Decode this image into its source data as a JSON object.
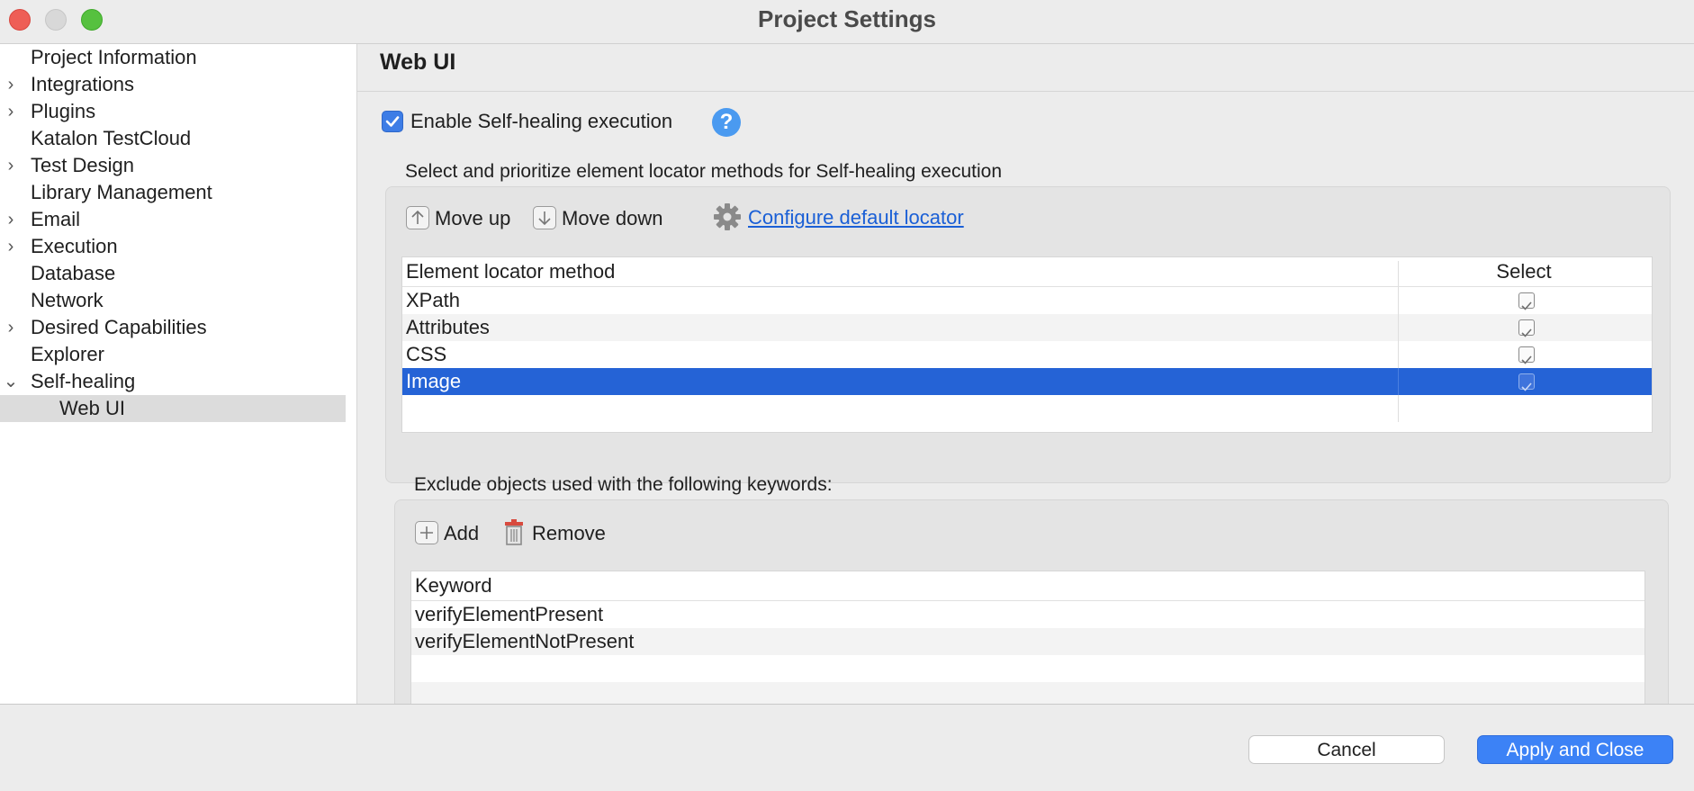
{
  "window": {
    "title": "Project Settings"
  },
  "sidebar": {
    "items": [
      {
        "label": "Project Information",
        "expander": ""
      },
      {
        "label": "Integrations",
        "expander": "›"
      },
      {
        "label": "Plugins",
        "expander": "›"
      },
      {
        "label": "Katalon TestCloud",
        "expander": ""
      },
      {
        "label": "Test Design",
        "expander": "›"
      },
      {
        "label": "Library Management",
        "expander": ""
      },
      {
        "label": "Email",
        "expander": "›"
      },
      {
        "label": "Execution",
        "expander": "›"
      },
      {
        "label": "Database",
        "expander": ""
      },
      {
        "label": "Network",
        "expander": ""
      },
      {
        "label": "Desired Capabilities",
        "expander": "›"
      },
      {
        "label": "Explorer",
        "expander": ""
      },
      {
        "label": "Self-healing",
        "expander": "⌄"
      },
      {
        "label": "Web UI",
        "expander": "",
        "selected": true
      }
    ]
  },
  "main": {
    "title": "Web UI",
    "enable_label": "Enable Self-healing execution",
    "enable_checked": true,
    "help_icon": "?",
    "locator_caption": "Select and prioritize element locator methods for Self-healing execution",
    "toolbar": {
      "move_up": "Move up",
      "move_down": "Move down",
      "configure": "Configure default locator"
    },
    "locator_table": {
      "headers": [
        "Element locator method",
        "Select"
      ],
      "rows": [
        {
          "method": "XPath",
          "selected": true
        },
        {
          "method": "Attributes",
          "selected": true
        },
        {
          "method": "CSS",
          "selected": true
        },
        {
          "method": "Image",
          "selected": true,
          "highlighted": true
        }
      ]
    },
    "exclude_caption": "Exclude objects used with the following keywords:",
    "exclude_toolbar": {
      "add": "Add",
      "remove": "Remove"
    },
    "keyword_table": {
      "header": "Keyword",
      "rows": [
        "verifyElementPresent",
        "verifyElementNotPresent"
      ]
    }
  },
  "footer": {
    "cancel": "Cancel",
    "apply": "Apply and Close"
  },
  "colors": {
    "accent": "#3c82f6",
    "selection": "#2563d6",
    "link": "#1a5fd6"
  }
}
